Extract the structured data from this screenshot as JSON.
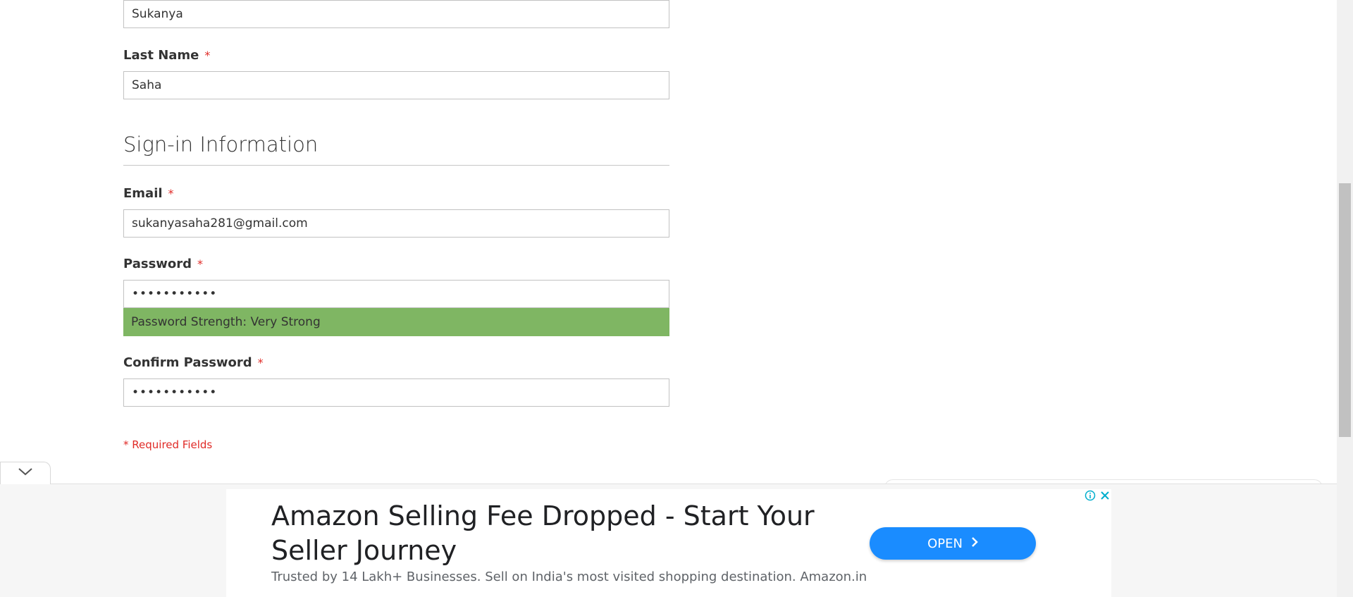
{
  "form": {
    "first_name_value": "Sukanya",
    "last_name_label": "Last Name",
    "last_name_value": "Saha",
    "required_marker": "*",
    "signin_legend": "Sign-in Information",
    "email_label": "Email",
    "email_value": "sukanyasaha281@gmail.com",
    "password_label": "Password",
    "password_value": "•••••••••••",
    "password_strength": "Password Strength: Very Strong",
    "confirm_password_label": "Confirm Password",
    "confirm_password_value": "•••••••••••",
    "required_fields_note": "* Required Fields"
  },
  "ad": {
    "title": "Amazon Selling Fee Dropped - Start Your Seller Journey",
    "description": "Trusted by 14 Lakh+ Businesses. Sell on India's most visited shopping destination. Amazon.in",
    "cta_label": "OPEN",
    "cta_icon": "chevron-right-icon",
    "info_icon": "info-icon",
    "close_icon": "close-icon",
    "cta_color": "#1a8cff"
  },
  "colors": {
    "strength_bar": "#7fb663",
    "required": "#e02b27"
  }
}
